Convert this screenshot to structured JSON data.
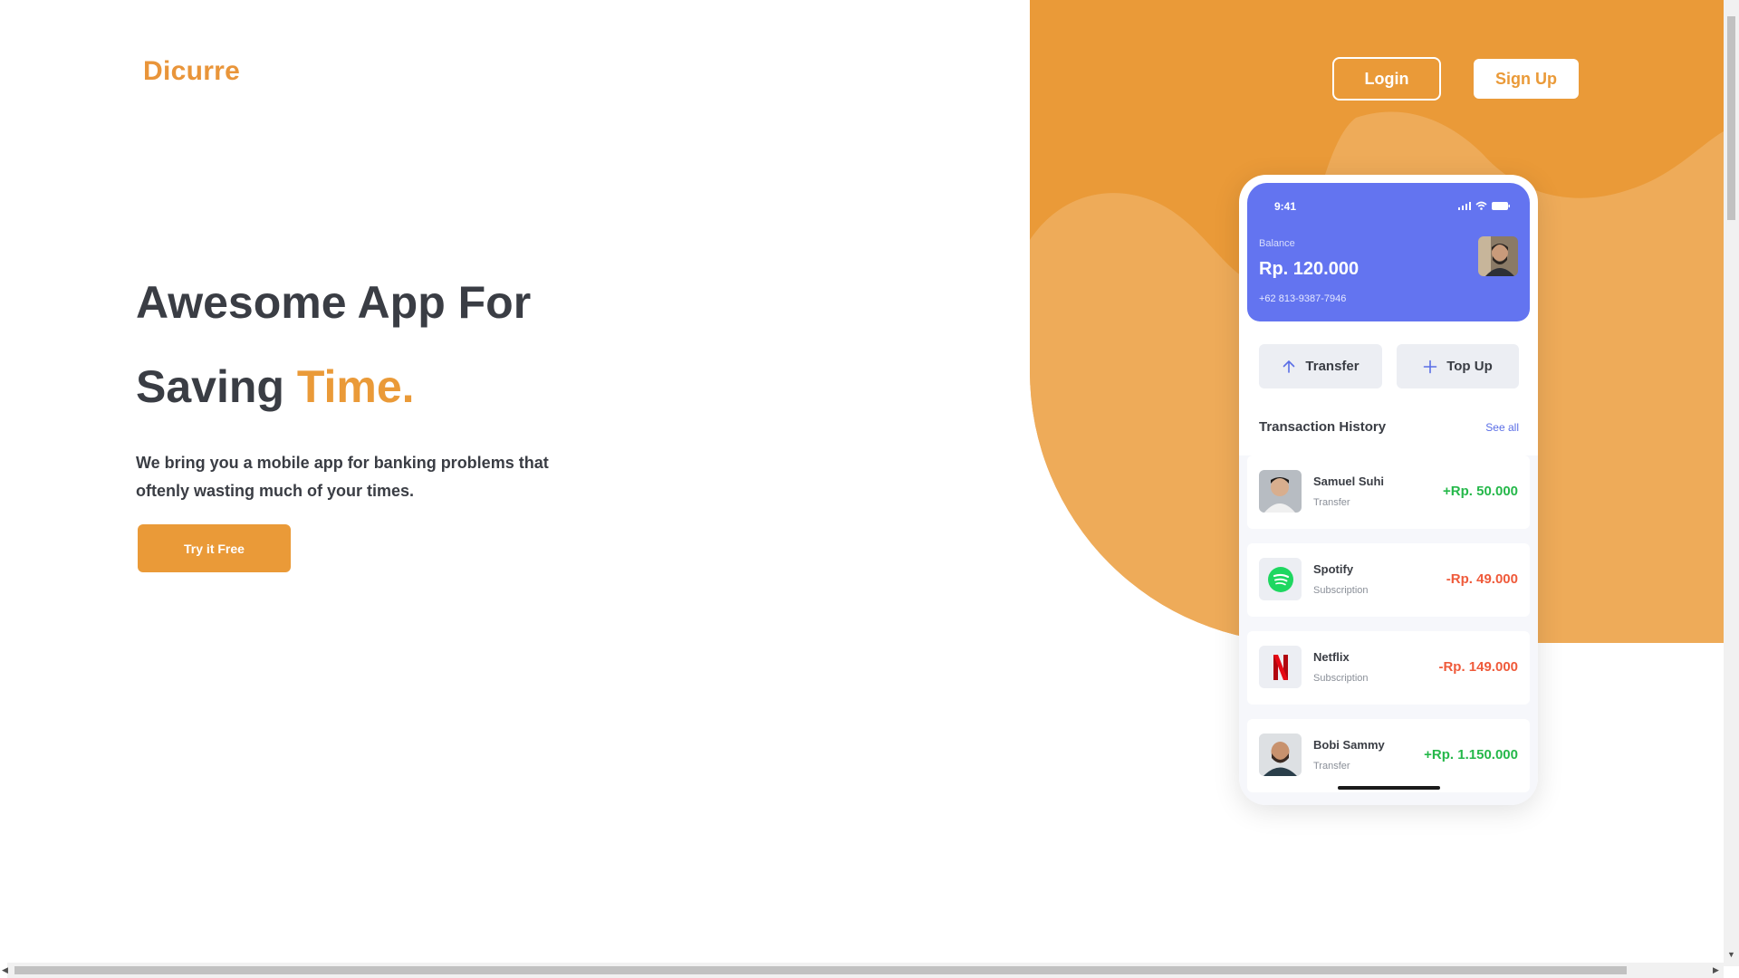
{
  "brand": "Dicurre",
  "nav": {
    "login": "Login",
    "signup": "Sign Up"
  },
  "hero": {
    "line1": "Awesome App For",
    "line2": "Saving",
    "accent": "Time.",
    "subtext": "We bring you a mobile app for banking problems that oftenly wasting much of your times.",
    "cta": "Try it Free"
  },
  "phone": {
    "time": "9:41",
    "balance_label": "Balance",
    "balance_value": "Rp. 120.000",
    "phone_number": "+62 813-9387-7946",
    "actions": {
      "transfer": "Transfer",
      "topup": "Top Up"
    },
    "history_title": "Transaction History",
    "see_all": "See all",
    "transactions": [
      {
        "name": "Samuel Suhi",
        "type": "Transfer",
        "amount": "+Rp. 50.000",
        "icon": "avatar-samuel"
      },
      {
        "name": "Spotify",
        "type": "Subscription",
        "amount": "-Rp. 49.000",
        "icon": "spotify-icon"
      },
      {
        "name": "Netflix",
        "type": "Subscription",
        "amount": "-Rp. 149.000",
        "icon": "netflix-icon"
      },
      {
        "name": "Bobi Sammy",
        "type": "Transfer",
        "amount": "+Rp. 1.150.000",
        "icon": "avatar-bobi"
      }
    ]
  },
  "colors": {
    "accent": "#ea9a38",
    "phone_header": "#6374f0",
    "positive": "#25b84a",
    "negative": "#ef5a3a"
  }
}
